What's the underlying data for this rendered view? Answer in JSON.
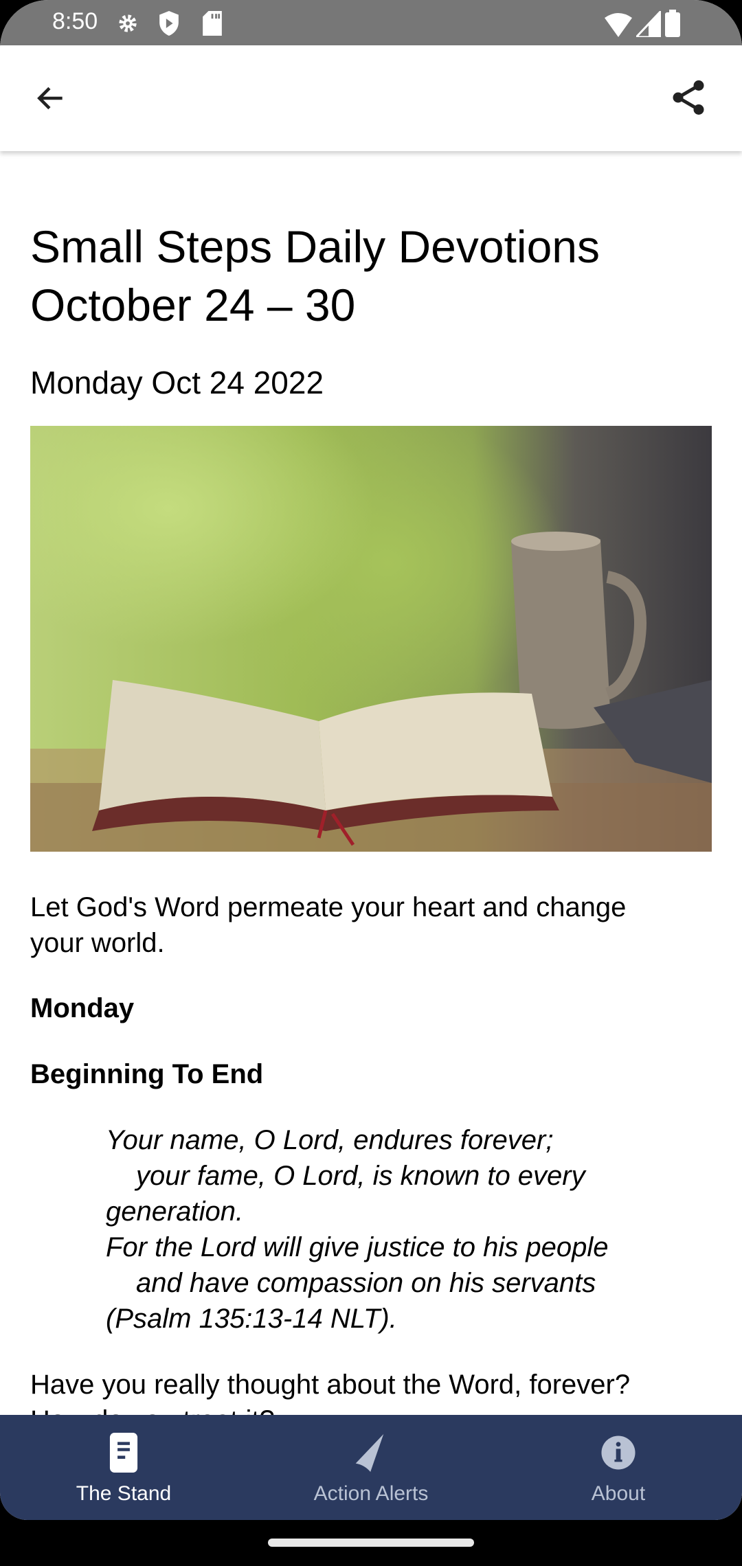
{
  "status_bar": {
    "time": "8:50",
    "icons": [
      "gear-icon",
      "shield-play-icon",
      "sd-card-icon",
      "wifi-icon",
      "signal-icon",
      "battery-icon"
    ]
  },
  "app_bar": {
    "back_icon": "arrow-back-icon",
    "share_icon": "share-icon"
  },
  "article": {
    "title_line1": "Small Steps Daily Devotions",
    "title_line2": "October 24 – 30",
    "date": "Monday Oct 24 2022",
    "intro_line1": "Let God's Word permeate your heart and change",
    "intro_line2": "your world.",
    "day": "Monday",
    "heading": "Beginning To End",
    "verse": [
      "Your name, O Lord, endures forever;",
      "your fame, O Lord, is known to every",
      "generation.",
      "For the Lord will give justice to his people",
      "and have compassion on his servants",
      "(Psalm 135:13-14 NLT)."
    ],
    "para_line1": "Have you really thought about the Word, forever?",
    "para_line2": "How do you treat it?"
  },
  "bottom_nav": {
    "items": [
      {
        "label": "The Stand",
        "icon": "document-icon",
        "active": true
      },
      {
        "label": "Action Alerts",
        "icon": "send-icon",
        "active": false
      },
      {
        "label": "About",
        "icon": "info-icon",
        "active": false
      }
    ],
    "background": "#2b3a5f"
  }
}
